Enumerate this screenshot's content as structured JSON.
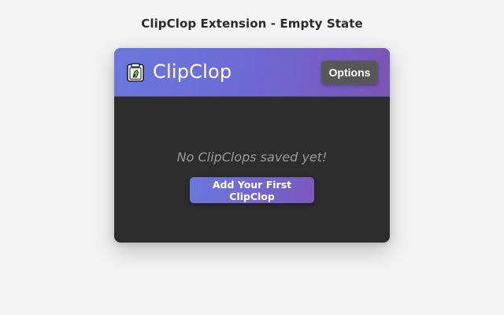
{
  "page": {
    "heading": "ClipClop Extension - Empty State"
  },
  "popup": {
    "header": {
      "logo_icon": "clipboard-icon",
      "title": "ClipClop",
      "options_label": "Options"
    },
    "empty_state": {
      "message": "No ClipClops saved yet!",
      "add_button_label": "Add Your First ClipClop"
    }
  },
  "colors": {
    "page_background": "#f4f4f4",
    "header_gradient_start": "#6a78dd",
    "header_gradient_end": "#7a55b6",
    "body_background": "#2d2d2d",
    "options_button": "#575757",
    "empty_text": "#9a9a9a"
  }
}
